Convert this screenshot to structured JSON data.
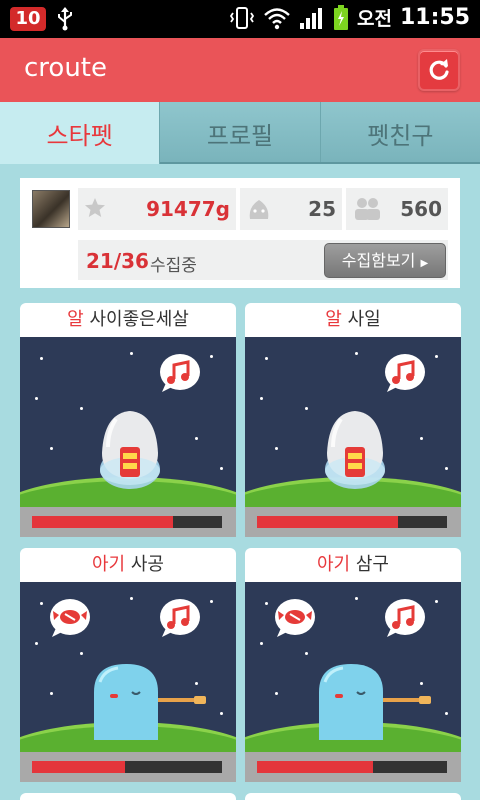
{
  "status_bar": {
    "time": "11:55",
    "ampm": "오전",
    "notification": "10"
  },
  "app_bar": {
    "title": "croute"
  },
  "tabs": [
    {
      "label": "스타펫",
      "active": true
    },
    {
      "label": "프로필",
      "active": false
    },
    {
      "label": "펫친구",
      "active": false
    }
  ],
  "profile": {
    "points": "91477g",
    "likes": "25",
    "friends": "560",
    "collection_count": "21/36",
    "collection_label": "수집중",
    "collection_button": "수집함보기"
  },
  "pets": [
    {
      "stage": "알",
      "name": "사이좋은세살",
      "type": "egg",
      "progress": 0.74,
      "bubbles": [
        "music"
      ]
    },
    {
      "stage": "알",
      "name": "사일",
      "type": "egg",
      "progress": 0.74,
      "bubbles": [
        "music"
      ]
    },
    {
      "stage": "아기",
      "name": "사공",
      "type": "baby",
      "progress": 0.49,
      "bubbles": [
        "candy",
        "music"
      ]
    },
    {
      "stage": "아기",
      "name": "삼구",
      "type": "baby",
      "progress": 0.61,
      "bubbles": [
        "candy",
        "music"
      ]
    }
  ],
  "colors": {
    "accent": "#ea5458",
    "tab_active_text": "#e8383c",
    "background": "#a8dbe0",
    "bar_fill": "#e4353b"
  }
}
